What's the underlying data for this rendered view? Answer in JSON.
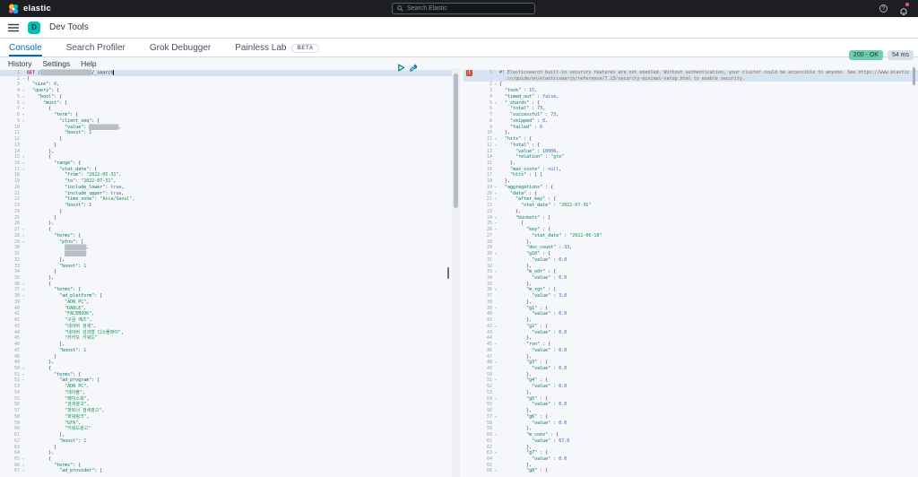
{
  "colors": {
    "navbar_bg": "#1d1e24",
    "accent_pink": "#f04e98",
    "teal": "#00bfb3",
    "link_blue": "#006bb4",
    "border": "#d3dae6",
    "ok_badge": "#6dccb1",
    "t_method": "#c80a68",
    "t_key": "#00756c",
    "t_str": "#0f9154",
    "t_num": "#3f5fc2",
    "t_warn": "#8a6d3b"
  },
  "icons": {
    "logo": "elastic-logo",
    "search": "magnifier",
    "help": "question-circle",
    "notifications": "bell-with-pink-dot",
    "menu": "hamburger",
    "send_request": "green-play-triangle",
    "request_options": "wrench",
    "response_error": "red-alert-square"
  },
  "navbar": {
    "brand": "elastic",
    "search_placeholder": "Search Elastic"
  },
  "breadcrumb": {
    "space_initial": "D",
    "title": "Dev Tools"
  },
  "tabs": {
    "items": [
      {
        "label": "Console",
        "active": true
      },
      {
        "label": "Search Profiler",
        "active": false
      },
      {
        "label": "Grok Debugger",
        "active": false
      },
      {
        "label": "Painless Lab",
        "active": false,
        "badge": "BETA"
      }
    ]
  },
  "toolbar": {
    "links": [
      "History",
      "Settings",
      "Help"
    ]
  },
  "status": {
    "code": "200 - OK",
    "duration": "54 ms"
  },
  "request": {
    "highlight_rows": [
      0
    ],
    "cursor_row": 0,
    "lines": [
      "GET /███████████████████/_search",
      "{",
      "  \"size\": 0,",
      "  \"query\": {",
      "    \"bool\": {",
      "      \"must\": [",
      "        {",
      "          \"term\": {",
      "            \"client_seq\": {",
      "              \"value\": ███████████,",
      "              \"boost\": 1",
      "            }",
      "          }",
      "        },",
      "        {",
      "          \"range\": {",
      "            \"stat_date\": {",
      "              \"from\": \"2022-05-31\",",
      "              \"to\": \"2022-07-31\",",
      "              \"include_lower\": true,",
      "              \"include_upper\": true,",
      "              \"time_zone\": \"Asia/Seoul\",",
      "              \"boost\": 1",
      "            }",
      "          }",
      "        },",
      "        {",
      "          \"terms\": {",
      "            \"pfno\": [",
      "              ████████,",
      "              ████████",
      "            ],",
      "            \"boost\": 1",
      "          }",
      "        },",
      "        {",
      "          \"terms\": {",
      "            \"ad_platform\": [",
      "              \"ADN PC\",",
      "              \"DABLE\",",
      "              \"FACEBOOK\",",
      "              \"구글 애즈\",",
      "              \"네이버 검색\",",
      "              \"네이버 성과형 디스플레이\",",
      "              \"카카오 키워드\"",
      "            ],",
      "            \"boost\": 1",
      "          }",
      "        },",
      "        {",
      "          \"terms\": {",
      "            \"ad_program\": [",
      "              \"ADN PC\",",
      "              \"데이블\",",
      "              \"페이스북\",",
      "              \"검색광고\",",
      "              \"파트너 검색광고\",",
      "              \"파워링크\",",
      "              \"GFA\",",
      "              \"키워드광고\"",
      "            ],",
      "            \"boost\": 1",
      "          }",
      "        },",
      "        {",
      "          \"terms\": {",
      "            \"ad_provider\": ["
    ]
  },
  "response": {
    "warning_rows": [
      0,
      1
    ],
    "highlight_rows": [
      0,
      1
    ],
    "continuation_rows": [
      1
    ],
    "lines": [
      "#! Elasticsearch built-in security features are not enabled. Without authentication, your cluster could be accessible to anyone. See https://www.elastic",
      ".co/guide/en/elasticsearch/reference/7.13/security-minimal-setup.html to enable security.",
      "{",
      "  \"took\" : 15,",
      "  \"timed_out\" : false,",
      "  \"_shards\" : {",
      "    \"total\" : 73,",
      "    \"successful\" : 73,",
      "    \"skipped\" : 0,",
      "    \"failed\" : 0",
      "  },",
      "  \"hits\" : {",
      "    \"total\" : {",
      "      \"value\" : 10000,",
      "      \"relation\" : \"gte\"",
      "    },",
      "    \"max_score\" : null,",
      "    \"hits\" : [ ]",
      "  },",
      "  \"aggregations\" : {",
      "    \"data\" : {",
      "      \"after_key\" : {",
      "        \"stat_date\" : \"2022-07-31\"",
      "      },",
      "      \"buckets\" : [",
      "        {",
      "          \"key\" : {",
      "            \"stat_date\" : \"2022-06-18\"",
      "          },",
      "          \"doc_count\" : 33,",
      "          \"g10\" : {",
      "            \"value\" : 0.0",
      "          },",
      "          \"m_odr\" : {",
      "            \"value\" : 0.0",
      "          },",
      "          \"m_rgr\" : {",
      "            \"value\" : 3.0",
      "          },",
      "          \"g1\" : {",
      "            \"value\" : 0.0",
      "          },",
      "          \"g2\" : {",
      "            \"value\" : 0.0",
      "          },",
      "          \"rvn\" : {",
      "            \"value\" : 0.0",
      "          },",
      "          \"g3\" : {",
      "            \"value\" : 0.0",
      "          },",
      "          \"g4\" : {",
      "            \"value\" : 0.0",
      "          },",
      "          \"g5\" : {",
      "            \"value\" : 0.0",
      "          },",
      "          \"g6\" : {",
      "            \"value\" : 0.0",
      "          },",
      "          \"m_conv\" : {",
      "            \"value\" : 67.0",
      "          },",
      "          \"g7\" : {",
      "            \"value\" : 0.0",
      "          },",
      "          \"g8\" : {"
    ]
  }
}
